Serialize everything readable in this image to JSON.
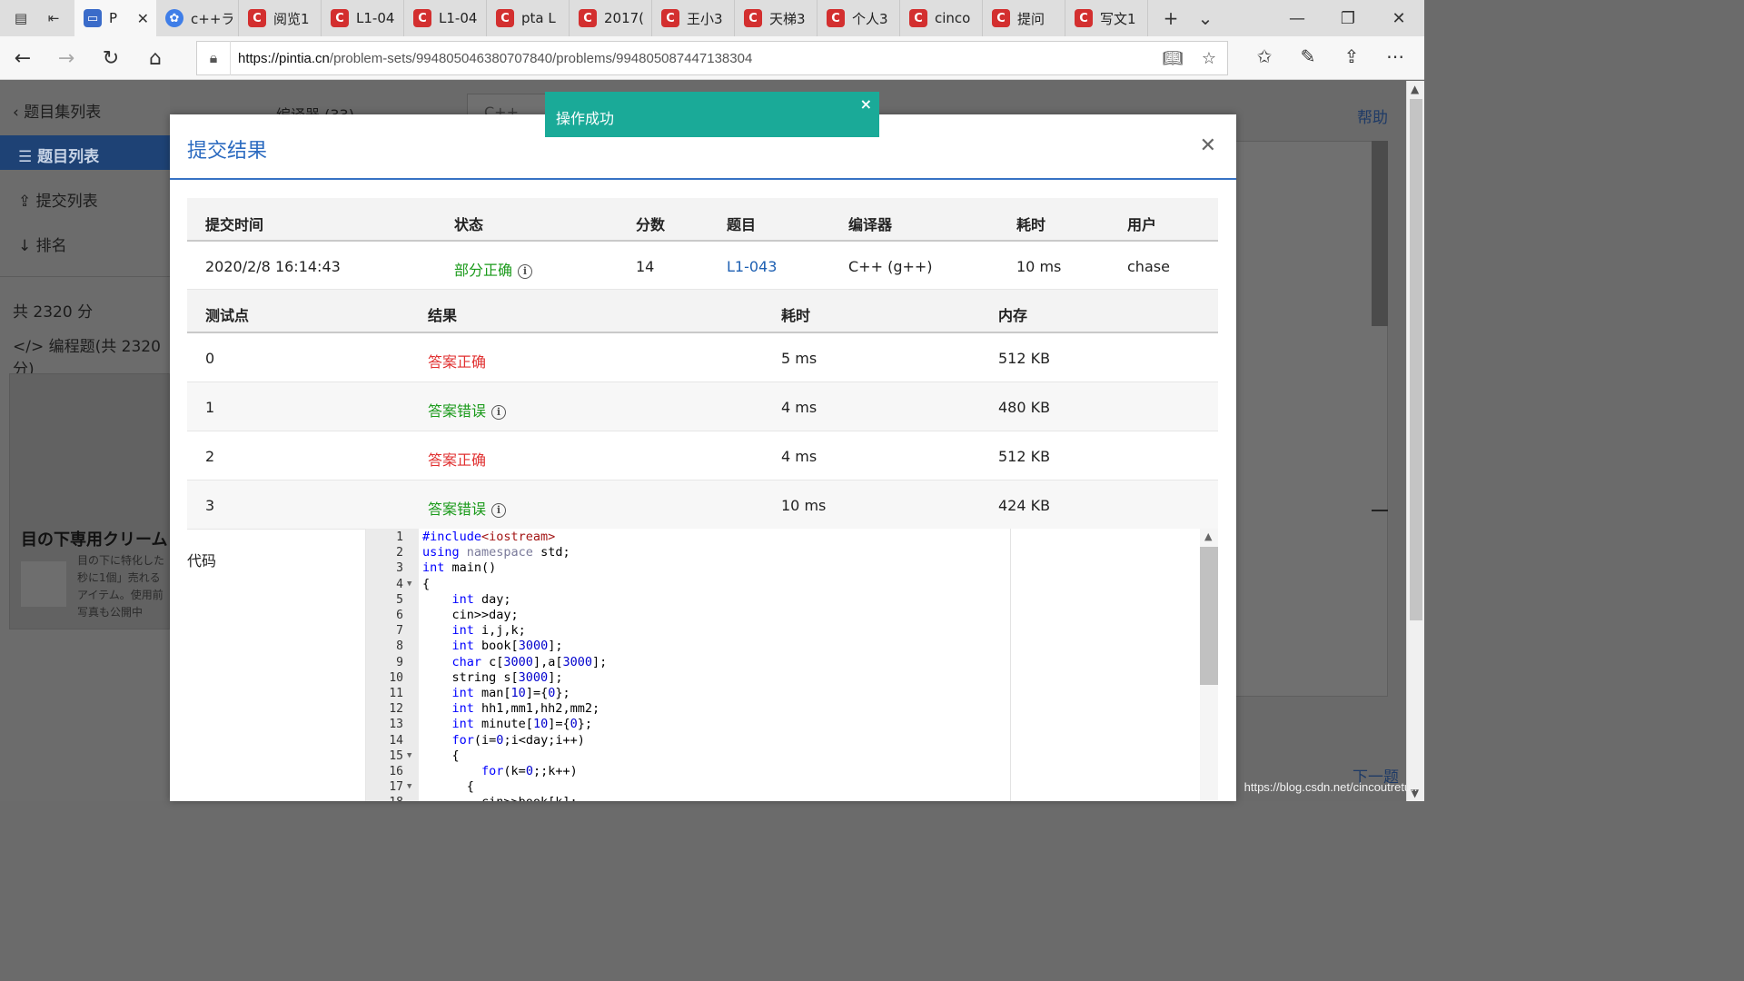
{
  "browser": {
    "tabs": [
      {
        "title": "P",
        "icon": "pta",
        "active": true
      },
      {
        "title": "c++ラ",
        "icon": "baidu"
      },
      {
        "title": "阅览1",
        "icon": "csdn"
      },
      {
        "title": "L1-04",
        "icon": "csdn"
      },
      {
        "title": "L1-04",
        "icon": "csdn"
      },
      {
        "title": "pta L",
        "icon": "csdn"
      },
      {
        "title": "2017(",
        "icon": "csdn"
      },
      {
        "title": "王小3",
        "icon": "csdn"
      },
      {
        "title": "天梯3",
        "icon": "csdn"
      },
      {
        "title": "个人3",
        "icon": "csdn"
      },
      {
        "title": "cinco",
        "icon": "csdn"
      },
      {
        "title": "提问",
        "icon": "csdn"
      },
      {
        "title": "写文1",
        "icon": "csdn"
      }
    ],
    "url_domain": "https://pintia.cn",
    "url_path": "/problem-sets/994805046380707840/problems/994805087447138304"
  },
  "background_page": {
    "back_label": "题目集列表",
    "nav": [
      "题目列表",
      "提交列表",
      "排名"
    ],
    "total_score": "共 2320 分",
    "programming_score": "编程题(共 2320 分)",
    "compiler_label": "编译器 (33)",
    "compiler_value": "C++ (g++)",
    "help": "帮助",
    "next": "下一题",
    "ad_title": "目の下専用クリーム",
    "ad_lines": [
      "目の下に特化した",
      "秒に1個」売れる",
      "アイテム。使用前",
      "写真も公開中"
    ]
  },
  "toast": {
    "message": "操作成功"
  },
  "modal": {
    "title": "提交结果",
    "summary_headers": [
      "提交时间",
      "状态",
      "分数",
      "题目",
      "编译器",
      "耗时",
      "用户"
    ],
    "summary": {
      "time": "2020/2/8 16:14:43",
      "status": "部分正确",
      "score": "14",
      "problem": "L1-043",
      "compiler": "C++ (g++)",
      "elapsed": "10 ms",
      "user": "chase"
    },
    "test_headers": [
      "测试点",
      "结果",
      "耗时",
      "内存"
    ],
    "tests": [
      {
        "id": "0",
        "result": "答案正确",
        "ok": true,
        "time": "5 ms",
        "memory": "512 KB"
      },
      {
        "id": "1",
        "result": "答案错误",
        "ok": false,
        "time": "4 ms",
        "memory": "480 KB"
      },
      {
        "id": "2",
        "result": "答案正确",
        "ok": true,
        "time": "4 ms",
        "memory": "512 KB"
      },
      {
        "id": "3",
        "result": "答案错误",
        "ok": false,
        "time": "10 ms",
        "memory": "424 KB"
      }
    ],
    "code_label": "代码",
    "code_lines": [
      "#include<iostream>",
      "using namespace std;",
      "int main()",
      "{",
      "    int day;",
      "    cin>>day;",
      "    int i,j,k;",
      "    int book[3000];",
      "    char c[3000],a[3000];",
      "    string s[3000];",
      "    int man[10]={0};",
      "    int hh1,mm1,hh2,mm2;",
      "    int minute[10]={0};",
      "    for(i=0;i<day;i++)",
      "    {",
      "        for(k=0;;k++)",
      "      {",
      "        cin>>book[k];"
    ],
    "fold_lines": [
      4,
      15,
      17
    ]
  },
  "watermark": "https://blog.csdn.net/cincoutretu..."
}
